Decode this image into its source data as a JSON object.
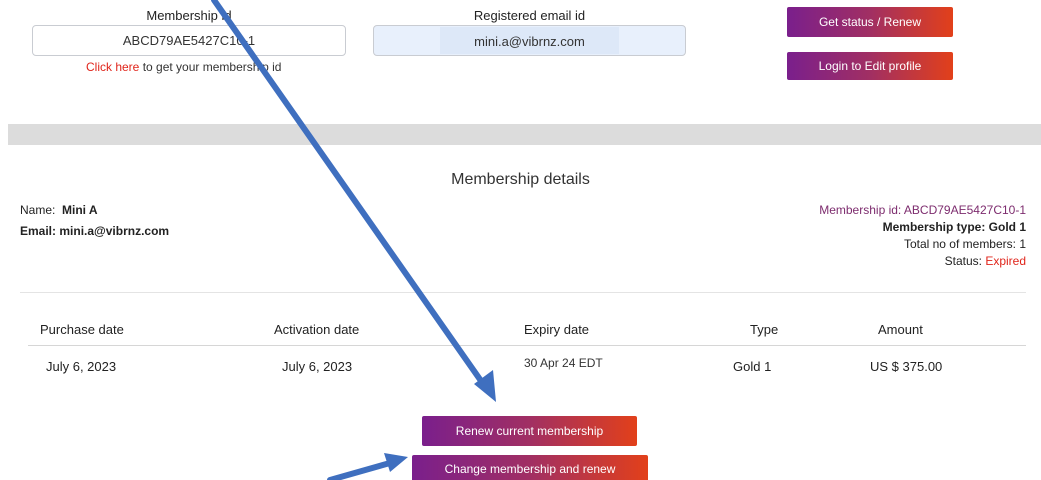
{
  "lookup": {
    "membership_label": "Membership id",
    "membership_value": "ABCD79AE5427C10-1",
    "help_link": "Click here",
    "help_rest": " to get your membership id",
    "email_label": "Registered email id",
    "email_value": "mini.a@vibrnz.com",
    "status_button": "Get status / Renew",
    "edit_button": "Login to Edit profile"
  },
  "details": {
    "title": "Membership details",
    "name_label": "Name:",
    "name_value": "Mini A",
    "email_label": "Email:",
    "email_value": "mini.a@vibrnz.com",
    "membership_id_text": "Membership id: ABCD79AE5427C10-1",
    "membership_type_text": "Membership type: Gold 1",
    "total_members_text": "Total no of members: 1",
    "status_label": "Status:",
    "status_value": "Expired"
  },
  "table": {
    "headers": [
      "Purchase date",
      "Activation date",
      "Expiry date",
      "Type",
      "Amount"
    ],
    "rows": [
      [
        "July 6, 2023",
        "July 6, 2023",
        "30 Apr 24 EDT",
        "Gold 1",
        "US $ 375.00"
      ]
    ]
  },
  "actions": {
    "renew_button": "Renew current membership",
    "change_button": "Change membership and renew"
  },
  "colors": {
    "accent_start": "#7a1f8c",
    "accent_end": "#e2401a",
    "link_red": "#e0251b",
    "id_purple": "#7d2c6e",
    "arrow_blue": "#3f6fbf"
  }
}
